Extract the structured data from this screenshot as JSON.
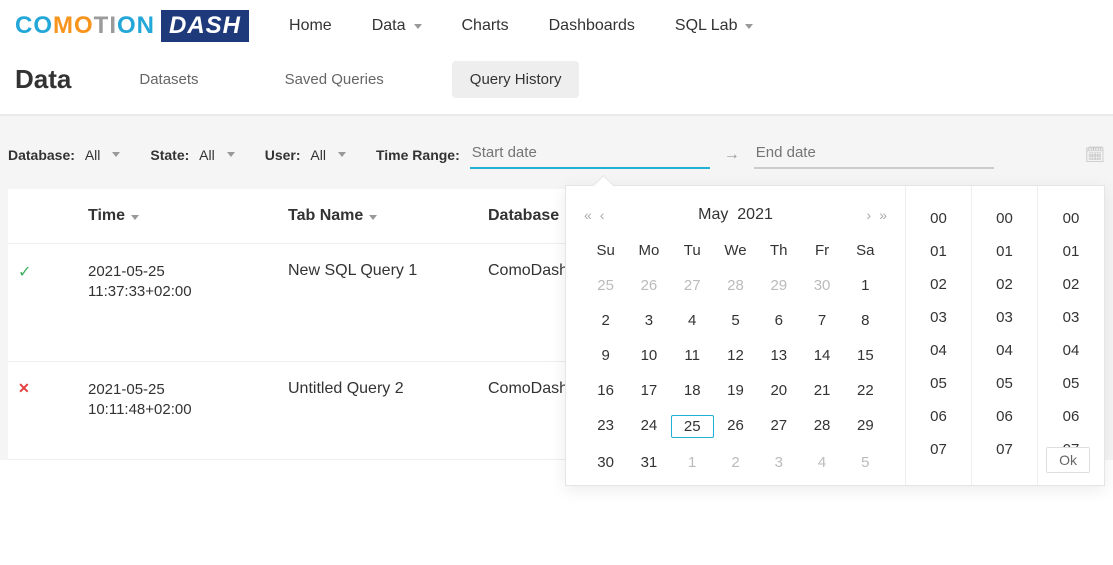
{
  "topnav": {
    "logo_parts": {
      "co": "CO",
      "mo": "MO",
      "ti": "TI",
      "on": "ON",
      "dash": "DASH"
    },
    "items": [
      "Home",
      "Data",
      "Charts",
      "Dashboards",
      "SQL Lab"
    ]
  },
  "page": {
    "title": "Data",
    "tabs": [
      "Datasets",
      "Saved Queries",
      "Query History"
    ],
    "active_tab": 2
  },
  "filters": {
    "database_label": "Database:",
    "database_value": "All",
    "state_label": "State:",
    "state_value": "All",
    "user_label": "User:",
    "user_value": "All",
    "time_range_label": "Time Range:",
    "start_placeholder": "Start date",
    "end_placeholder": "End date"
  },
  "table": {
    "headers": [
      "",
      "Time",
      "Tab Name",
      "Database",
      ""
    ],
    "rows": [
      {
        "status": "ok",
        "time": "2021-05-25 11:37:33+02:00",
        "tab_name": "New SQL Query 1",
        "database": "ComoDash for G"
      },
      {
        "status": "err",
        "time": "2021-05-25 10:11:48+02:00",
        "tab_name": "Untitled Query 2",
        "database": "ComoDash for G"
      }
    ]
  },
  "calendar": {
    "title_month": "May",
    "title_year": "2021",
    "dow": [
      "Su",
      "Mo",
      "Tu",
      "We",
      "Th",
      "Fr",
      "Sa"
    ],
    "cells": [
      {
        "n": "25",
        "m": true
      },
      {
        "n": "26",
        "m": true
      },
      {
        "n": "27",
        "m": true
      },
      {
        "n": "28",
        "m": true
      },
      {
        "n": "29",
        "m": true
      },
      {
        "n": "30",
        "m": true
      },
      {
        "n": "1"
      },
      {
        "n": "2"
      },
      {
        "n": "3"
      },
      {
        "n": "4"
      },
      {
        "n": "5"
      },
      {
        "n": "6"
      },
      {
        "n": "7"
      },
      {
        "n": "8"
      },
      {
        "n": "9"
      },
      {
        "n": "10"
      },
      {
        "n": "11"
      },
      {
        "n": "12"
      },
      {
        "n": "13"
      },
      {
        "n": "14"
      },
      {
        "n": "15"
      },
      {
        "n": "16"
      },
      {
        "n": "17"
      },
      {
        "n": "18"
      },
      {
        "n": "19"
      },
      {
        "n": "20"
      },
      {
        "n": "21"
      },
      {
        "n": "22"
      },
      {
        "n": "23"
      },
      {
        "n": "24"
      },
      {
        "n": "25",
        "t": true
      },
      {
        "n": "26"
      },
      {
        "n": "27"
      },
      {
        "n": "28"
      },
      {
        "n": "29"
      },
      {
        "n": "30"
      },
      {
        "n": "31"
      },
      {
        "n": "1",
        "m": true
      },
      {
        "n": "2",
        "m": true
      },
      {
        "n": "3",
        "m": true
      },
      {
        "n": "4",
        "m": true
      },
      {
        "n": "5",
        "m": true
      }
    ],
    "time_values": [
      "00",
      "01",
      "02",
      "03",
      "04",
      "05",
      "06",
      "07"
    ],
    "ok_label": "Ok"
  }
}
